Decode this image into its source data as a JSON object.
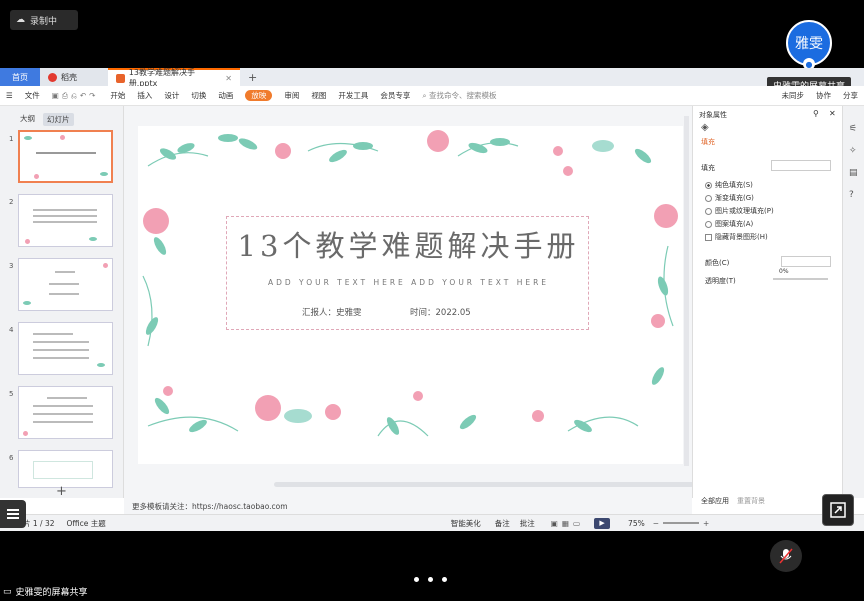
{
  "recording": {
    "label": "录制中"
  },
  "presenter": {
    "avatar_text": "雅雯",
    "share_tooltip": "史雅雯的屏幕共享"
  },
  "tabs": {
    "home": "首页",
    "daoke": "稻壳",
    "doc": "13教学难题解决手册.pptx"
  },
  "menu": {
    "file": "文件",
    "items": [
      "开始",
      "插入",
      "设计",
      "切换",
      "动画",
      "放映",
      "审阅",
      "视图",
      "开发工具",
      "会员专享"
    ],
    "active_index": 5,
    "search_placeholder": "查找命令、搜索模板",
    "sync": "未同步",
    "collab": "协作",
    "share": "分享"
  },
  "left_panel": {
    "tab_outline": "大纲",
    "tab_slides": "幻灯片",
    "slide_numbers": [
      "1",
      "2",
      "3",
      "4",
      "5",
      "6"
    ]
  },
  "slide": {
    "title": "13个教学难题解决手册",
    "subtitle": "ADD YOUR TEXT HERE  ADD YOUR TEXT HERE",
    "reporter": "汇报人：史雅雯",
    "time": "时间：2022.05"
  },
  "notes": {
    "text": "更多模板请关注：https://haosc.taobao.com"
  },
  "right_panel": {
    "title": "对象属性",
    "fill_tab": "填充",
    "fill_section": "填充",
    "options": [
      "纯色填充(S)",
      "渐变填充(G)",
      "图片或纹理填充(P)",
      "图案填充(A)"
    ],
    "hide_bg": "隐藏背景图形(H)",
    "color_label": "颜色(C)",
    "transparency_label": "透明度(T)",
    "transparency_value": "0%",
    "apply_all": "全部应用",
    "reset_bg": "重置背景"
  },
  "status": {
    "slide_counter": "幻灯片 1 / 32",
    "theme": "Office 主题",
    "smart": "智能美化",
    "notes": "备注",
    "comments": "批注",
    "zoom": "75%"
  },
  "footer": {
    "share_label": "史雅雯的屏幕共享"
  },
  "colors": {
    "accent": "#f07b2c",
    "avatar": "#1b6ce0",
    "home_tab": "#3f7ae0"
  }
}
